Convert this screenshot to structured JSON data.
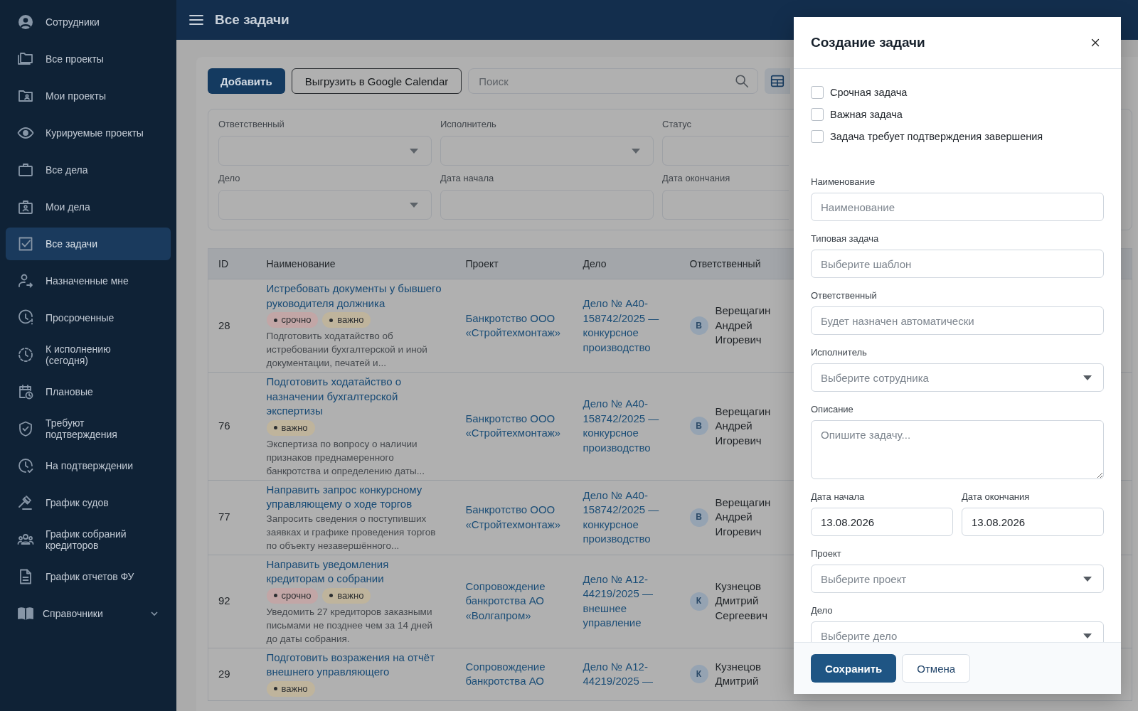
{
  "sidebar": {
    "items": [
      {
        "label": "Сотрудники",
        "selected": false
      },
      {
        "label": "Все проекты",
        "selected": false
      },
      {
        "label": "Мои проекты",
        "selected": false
      },
      {
        "label": "Курируемые проекты",
        "selected": false
      },
      {
        "label": "Все дела",
        "selected": false
      },
      {
        "label": "Мои дела",
        "selected": false
      },
      {
        "label": "Все задачи",
        "selected": true
      },
      {
        "label": "Назначенные мне",
        "selected": false
      },
      {
        "label": "Просроченные",
        "selected": false
      },
      {
        "label": "К исполнению (сегодня)",
        "selected": false
      },
      {
        "label": "Плановые",
        "selected": false
      },
      {
        "label": "Требуют подтверждения",
        "selected": false
      },
      {
        "label": "На подтверждении",
        "selected": false
      },
      {
        "label": "График судов",
        "selected": false
      },
      {
        "label": "График собраний кредиторов",
        "selected": false
      },
      {
        "label": "График отчетов ФУ",
        "selected": false
      },
      {
        "label": "Справочники",
        "selected": false,
        "expanded": false
      }
    ]
  },
  "header": {
    "title": "Все задачи"
  },
  "toolbar": {
    "add_button": "Добавить",
    "export_button": "Выгрузить в Google Calendar",
    "search": {
      "placeholder": "Поиск"
    }
  },
  "filters": [
    {
      "label": "Ответственный",
      "kind": "select"
    },
    {
      "label": "Исполнитель",
      "kind": "select"
    },
    {
      "label": "Статус",
      "kind": "input"
    },
    {
      "label": "Дело",
      "kind": "select"
    },
    {
      "label": "Дата начала",
      "kind": "input"
    },
    {
      "label": "Дата окончания",
      "kind": "input"
    }
  ],
  "table": {
    "columns": [
      "ID",
      "Наименование",
      "Проект",
      "Дело",
      "Ответственный"
    ],
    "rows": [
      {
        "id": "28",
        "title": "Истребовать документы у бывшего руководителя должника",
        "tags": [
          {
            "label": "срочно",
            "kind": "urgent"
          },
          {
            "label": "важно",
            "kind": "important"
          }
        ],
        "description": "Подготовить ходатайство об истребовании бухгалтерской и иной документации, печатей и...",
        "project": "Банкротство ООО «Стройтехмонтаж»",
        "case": "Дело № А40-158742/2025 — конкурсное производство",
        "responsible": {
          "initial": "В",
          "name": "Верещагин Андрей Игоревич"
        }
      },
      {
        "id": "76",
        "title": "Подготовить ходатайство о назначении бухгалтерской экспертизы",
        "tags": [
          {
            "label": "важно",
            "kind": "important"
          }
        ],
        "description": "Экспертиза по вопросу о наличии признаков преднамеренного банкротства и определению даты...",
        "project": "Банкротство ООО «Стройтехмонтаж»",
        "case": "Дело № А40-158742/2025 — конкурсное производство",
        "responsible": {
          "initial": "В",
          "name": "Верещагин Андрей Игоревич"
        }
      },
      {
        "id": "77",
        "title": "Направить запрос конкурсному управляющему о ходе торгов",
        "tags": [],
        "description": "Запросить сведения о поступивших заявках и графике проведения торгов по объекту незавершённого...",
        "project": "Банкротство ООО «Стройтехмонтаж»",
        "case": "Дело № А40-158742/2025 — конкурсное производство",
        "responsible": {
          "initial": "В",
          "name": "Верещагин Андрей Игоревич"
        }
      },
      {
        "id": "92",
        "title": "Направить уведомления кредиторам о собрании",
        "tags": [
          {
            "label": "срочно",
            "kind": "urgent"
          },
          {
            "label": "важно",
            "kind": "important"
          }
        ],
        "description": "Уведомить 27 кредиторов заказными письмами не позднее чем за 14 дней до даты собрания.",
        "project": "Сопровождение банкротства АО «Волгапром»",
        "case": "Дело № А12-44219/2025 — внешнее управление",
        "responsible": {
          "initial": "К",
          "name": "Кузнецов Дмитрий Сергеевич"
        }
      },
      {
        "id": "29",
        "title": "Подготовить возражения на отчёт внешнего управляющего",
        "tags": [
          {
            "label": "важно",
            "kind": "important"
          }
        ],
        "project": "Сопровождение банкротства АО",
        "case": "Дело № А12-44219/2025 —",
        "responsible": {
          "initial": "К",
          "name": "Кузнецов Дмитрий"
        }
      }
    ]
  },
  "modal": {
    "title": "Создание задачи",
    "checkboxes": [
      {
        "label": "Срочная задача",
        "checked": false
      },
      {
        "label": "Важная задача",
        "checked": false
      },
      {
        "label": "Задача требует подтверждения завершения",
        "checked": false
      }
    ],
    "fields": [
      {
        "label": "Наименование",
        "kind": "text",
        "placeholder": "Наименование"
      },
      {
        "label": "Типовая задача",
        "kind": "text",
        "placeholder": "Выберите шаблон"
      },
      {
        "label": "Ответственный",
        "kind": "text",
        "placeholder": "Будет назначен автоматически"
      },
      {
        "label": "Исполнитель",
        "kind": "select",
        "placeholder": "Выберите сотрудника"
      },
      {
        "label": "Описание",
        "kind": "textarea",
        "placeholder": "Опишите задачу..."
      },
      {
        "label": "Дата начала",
        "kind": "date",
        "value": "13.08.2026"
      },
      {
        "label": "Дата окончания",
        "kind": "date",
        "value": "13.08.2026"
      },
      {
        "label": "Проект",
        "kind": "select",
        "placeholder": "Выберите проект"
      },
      {
        "label": "Дело",
        "kind": "select",
        "placeholder": "Выберите дело"
      }
    ],
    "save_button": "Сохранить",
    "cancel_button": "Отмена"
  }
}
